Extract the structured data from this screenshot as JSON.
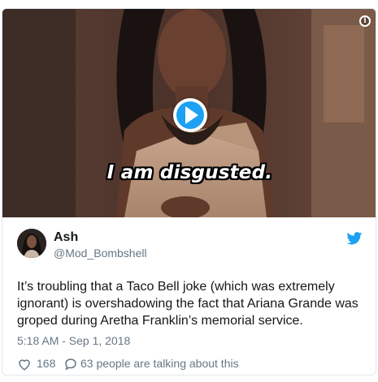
{
  "media": {
    "caption": "I am disgusted.",
    "accent_color": "#1da1f2",
    "play_icon": "play-icon",
    "info_icon": "info-icon"
  },
  "author": {
    "name": "Ash",
    "handle": "@Mod_Bombshell"
  },
  "tweet": {
    "text": "It’s troubling that a Taco Bell joke (which was extremely ignorant) is overshadowing the fact that Ariana Grande was groped during Aretha Franklin’s memorial service.",
    "timestamp": "5:18 AM - Sep 1, 2018"
  },
  "actions": {
    "like_count": "168",
    "reply_text": "63 people are talking about this"
  },
  "colors": {
    "brand": "#1da1f2",
    "text": "#14171a",
    "muted": "#657786",
    "border": "#e1e8ed"
  }
}
